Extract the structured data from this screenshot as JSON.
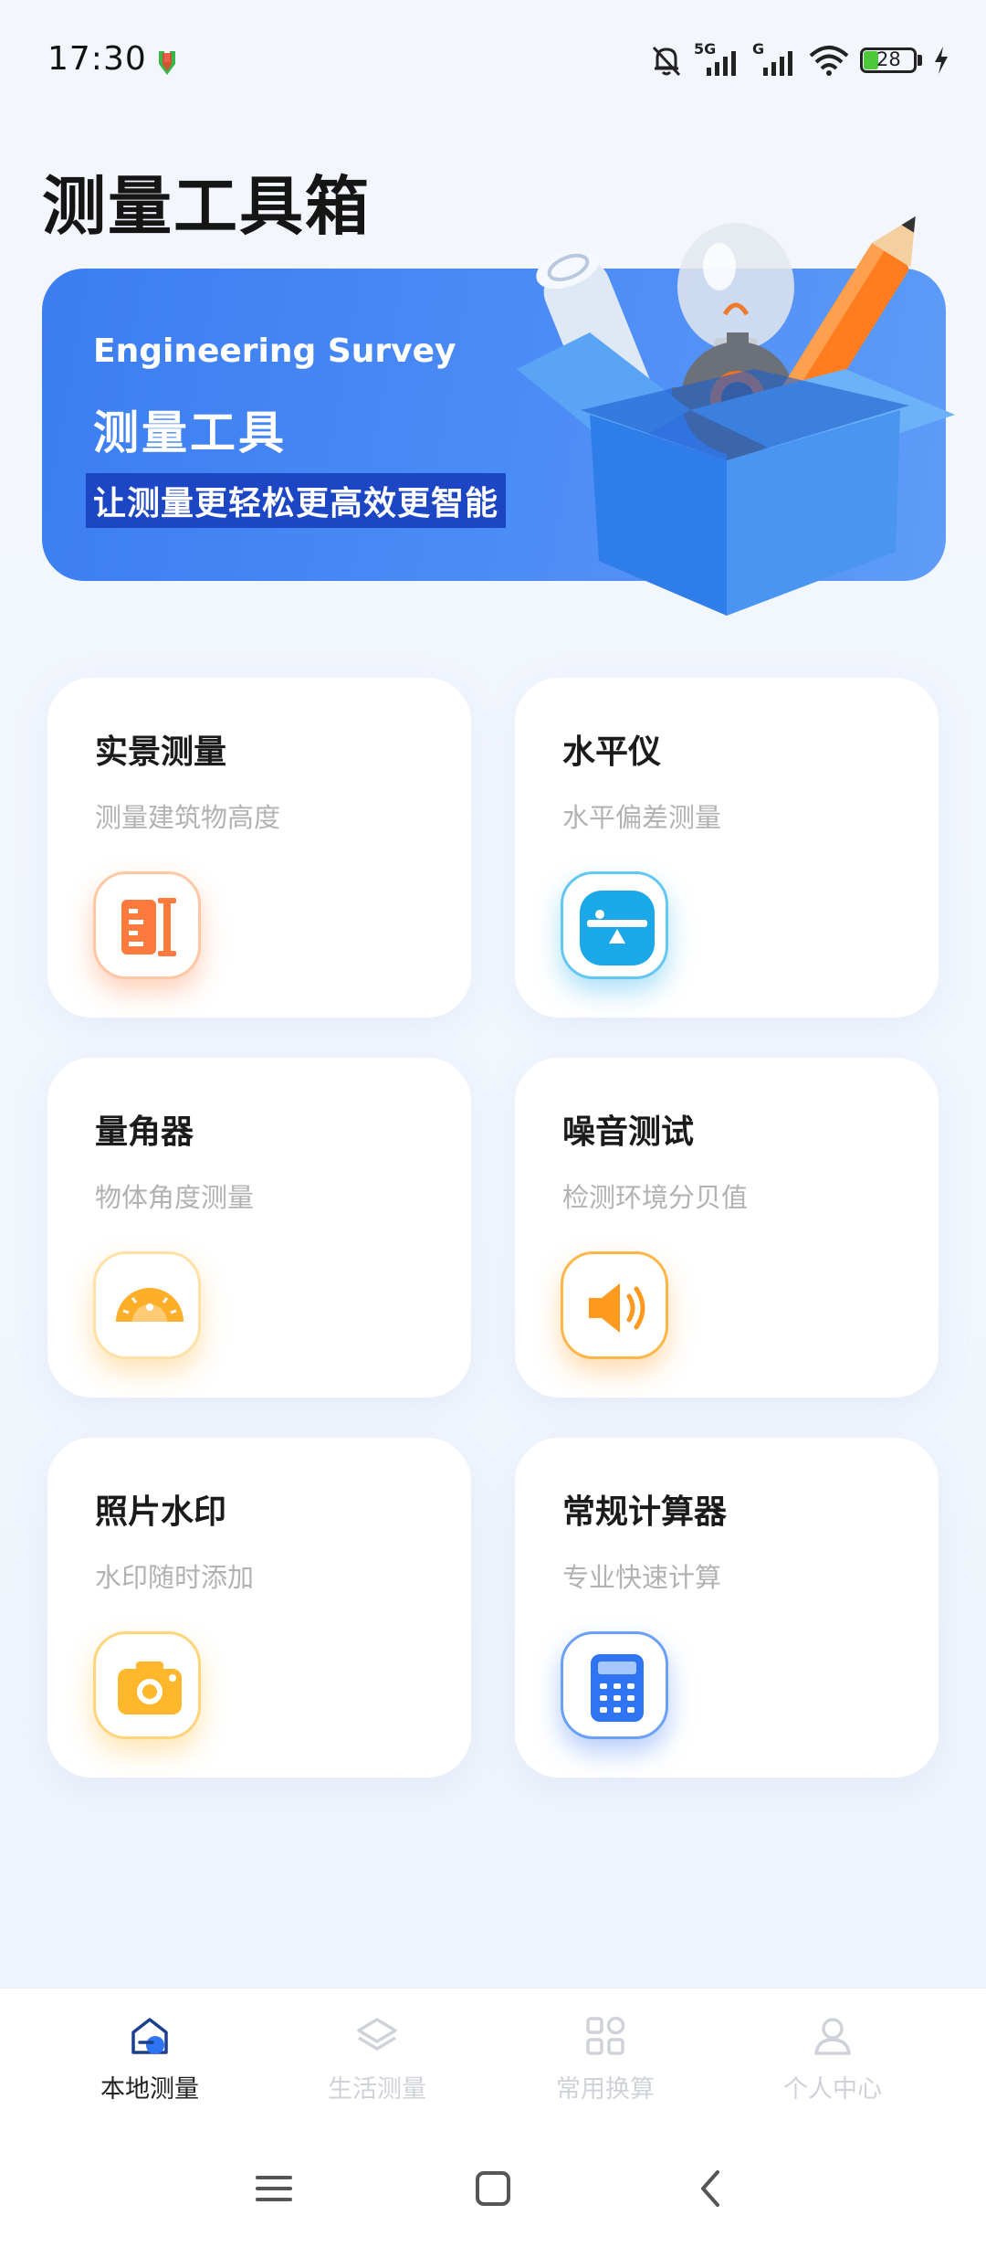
{
  "status_bar": {
    "time": "17:30",
    "network_1": "5G",
    "network_2": "G",
    "battery": "28"
  },
  "page": {
    "title": "测量工具箱"
  },
  "banner": {
    "en_title": "Engineering Survey",
    "cn_title": "测量工具",
    "slogan": "让测量更轻松更高效更智能"
  },
  "tools": [
    {
      "title": "实景测量",
      "subtitle": "测量建筑物高度",
      "icon": "ruler-icon",
      "color": "#ff7a3d"
    },
    {
      "title": "水平仪",
      "subtitle": "水平偏差测量",
      "icon": "level-icon",
      "color": "#1aa8e8"
    },
    {
      "title": "量角器",
      "subtitle": "物体角度测量",
      "icon": "protractor-icon",
      "color": "#ffae2a"
    },
    {
      "title": "噪音测试",
      "subtitle": "检测环境分贝值",
      "icon": "speaker-icon",
      "color": "#ff9a1f"
    },
    {
      "title": "照片水印",
      "subtitle": "水印随时添加",
      "icon": "camera-icon",
      "color": "#ffb72b"
    },
    {
      "title": "常规计算器",
      "subtitle": "专业快速计算",
      "icon": "calculator-icon",
      "color": "#2f74f2"
    }
  ],
  "bottom_nav": {
    "items": [
      {
        "label": "本地测量",
        "icon": "home-icon",
        "active": true
      },
      {
        "label": "生活测量",
        "icon": "layers-icon",
        "active": false
      },
      {
        "label": "常用换算",
        "icon": "grid-icon",
        "active": false
      },
      {
        "label": "个人中心",
        "icon": "person-icon",
        "active": false
      }
    ]
  },
  "colors": {
    "banner": "#3b7ef0",
    "slogan_bg": "#1d46c4",
    "active_nav": "#2f74f2"
  }
}
